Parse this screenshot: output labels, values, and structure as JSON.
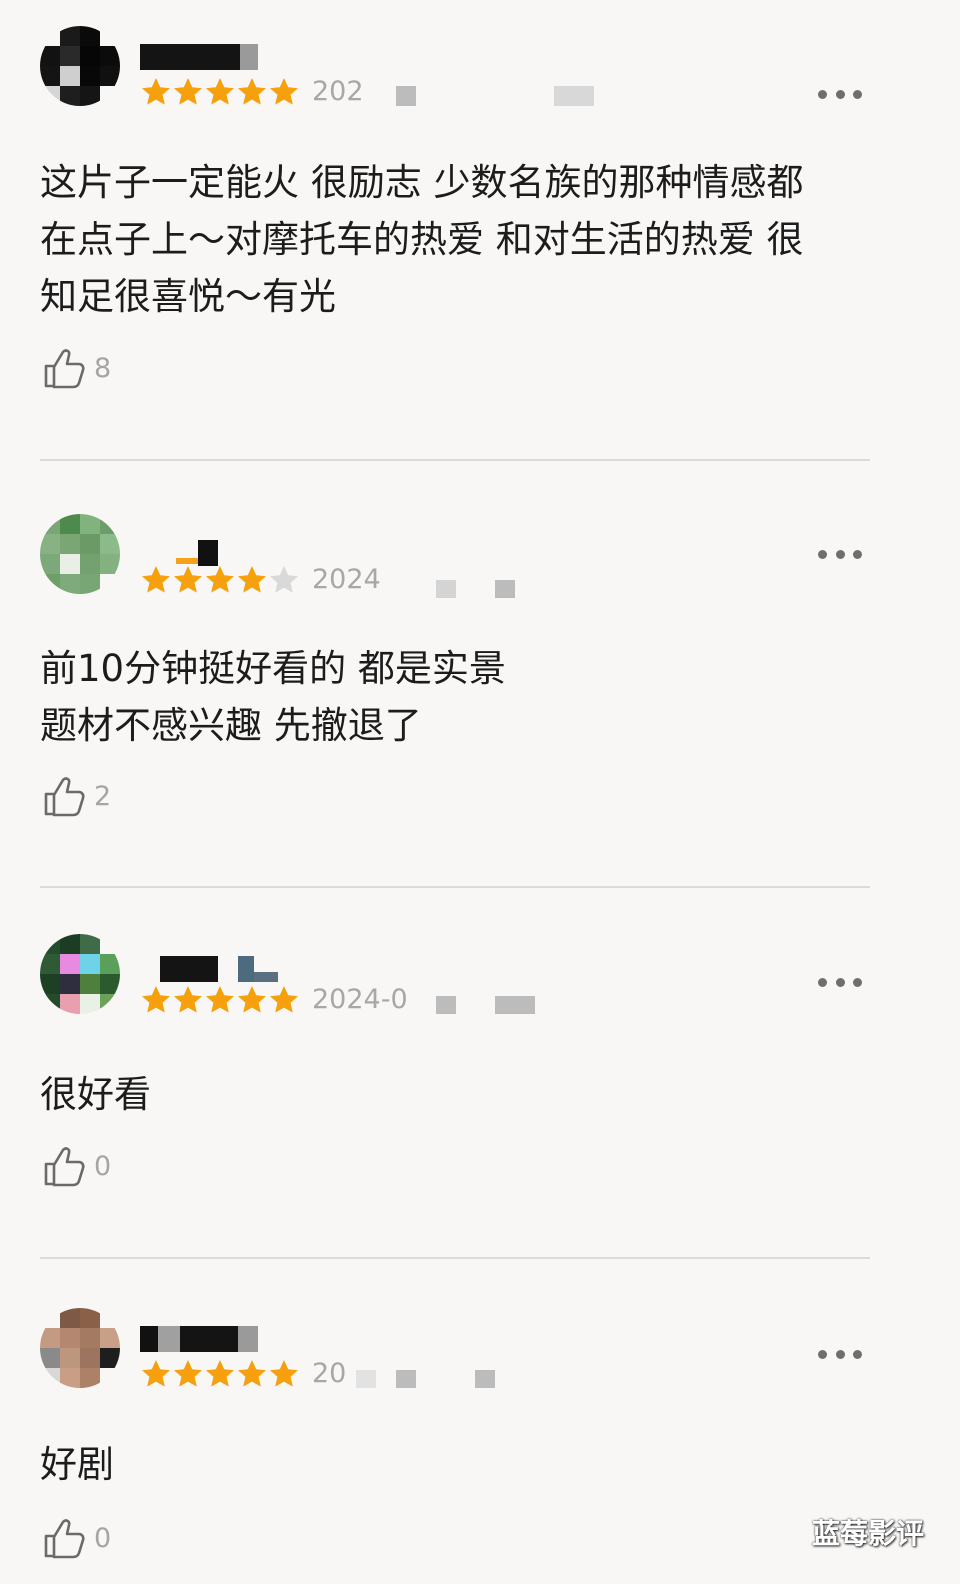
{
  "reviews": [
    {
      "rating": 5,
      "date": "202",
      "text": "这片子一定能火 很励志 少数名族的那种情感都\n在点子上～对摩托车的热爱 和对生活的热爱 很\n知足很喜悦～有光",
      "likes": "8"
    },
    {
      "rating": 4,
      "date": "2024",
      "text": "前10分钟挺好看的 都是实景\n题材不感兴趣 先撤退了",
      "likes": "2"
    },
    {
      "rating": 5,
      "date": "2024-0",
      "text": "很好看",
      "likes": "0"
    },
    {
      "rating": 5,
      "date": "20",
      "text": "好剧",
      "likes": "0"
    }
  ],
  "colors": {
    "star_filled": "#f5a00c",
    "star_empty": "#d9d9d9",
    "text": "#1c1c1c",
    "meta": "#a7a7a7",
    "divider": "#dadada",
    "background": "#f8f7f5"
  },
  "icons": {
    "more": "more-dots-icon",
    "like": "thumbs-up-icon",
    "star": "star-icon"
  },
  "watermark": "蓝莓影评"
}
